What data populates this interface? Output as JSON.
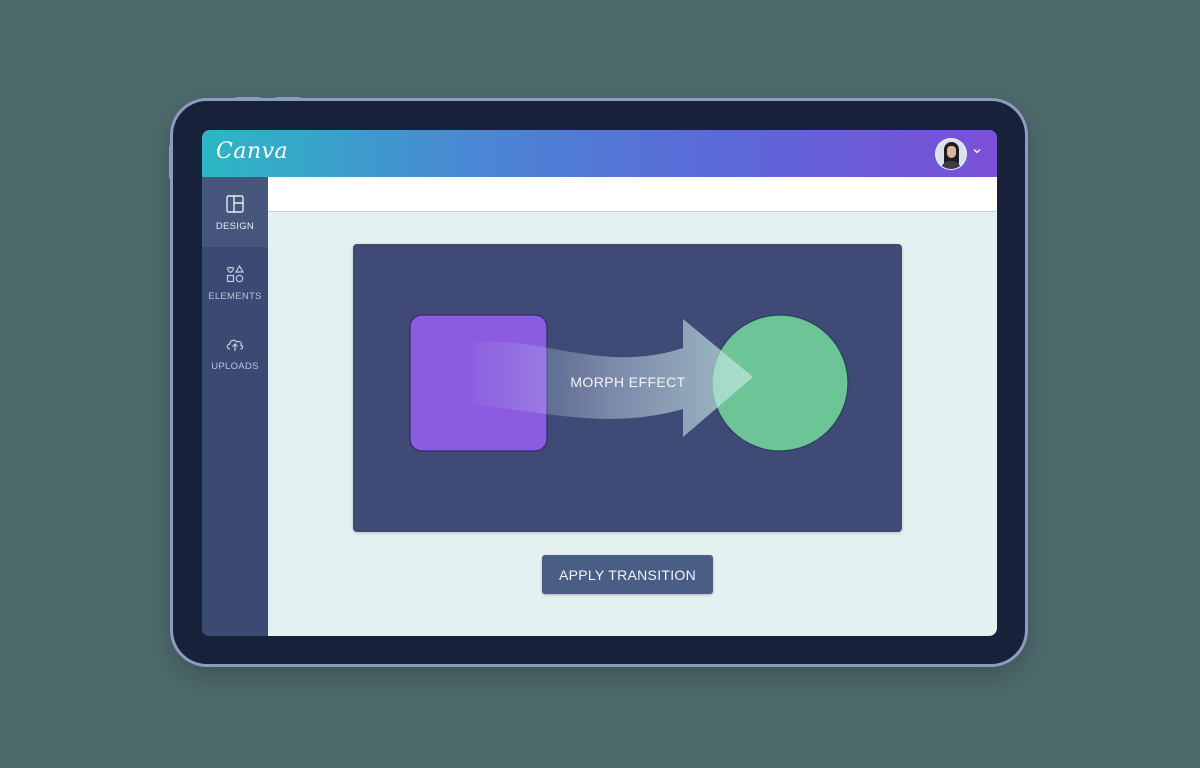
{
  "app": {
    "brand": "Canva"
  },
  "header": {
    "account_chevron": "⌄"
  },
  "sidebar": {
    "items": [
      {
        "label": "DESIGN",
        "icon": "layout-icon",
        "active": true
      },
      {
        "label": "ELEMENTS",
        "icon": "shapes-icon",
        "active": false
      },
      {
        "label": "UPLOADS",
        "icon": "cloud-upload-icon",
        "active": false
      }
    ]
  },
  "canvas": {
    "effect_label": "MORPH EFFECT"
  },
  "actions": {
    "apply_label": "APPLY TRANSITION"
  },
  "colors": {
    "square": "#8b5ce0",
    "circle": "#6cc497",
    "canvas": "#3f4b76",
    "sidebar": "#3a4a72"
  }
}
